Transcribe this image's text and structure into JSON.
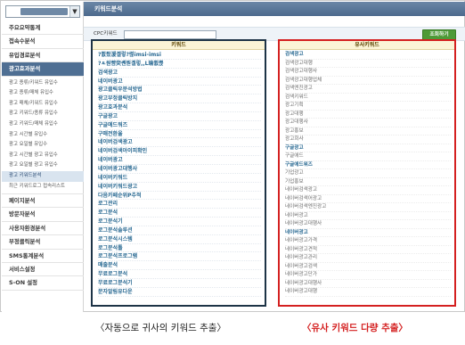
{
  "sidebar": {
    "site_select_icon": "chevron-down-icon",
    "menu": [
      {
        "label": "주요요약통계",
        "active": false
      },
      {
        "label": "접속수분석",
        "active": false
      },
      {
        "label": "유입경로분석",
        "active": false
      },
      {
        "label": "광고효과분석",
        "active": true
      }
    ],
    "submenu": [
      {
        "label": "광고 종류/키워드 유입수",
        "active": false
      },
      {
        "label": "광고 종류/매체 유입수",
        "active": false
      },
      {
        "label": "광고 매체/키워드 유입수",
        "active": false
      },
      {
        "label": "광고 키워드/종류 유입수",
        "active": false
      },
      {
        "label": "광고 키워드/매체 유입수",
        "active": false
      },
      {
        "label": "광고 시간별 유입수",
        "active": false
      },
      {
        "label": "광고 요일별 유입수",
        "active": false
      },
      {
        "label": "광고 시간별 광고 유입수",
        "active": false
      },
      {
        "label": "광고 요일별 광고 유입수",
        "active": false
      },
      {
        "label": "광고 키워드분석",
        "active": true
      },
      {
        "label": "최근 키워드로그 접속리스트",
        "active": false
      }
    ],
    "menu_bottom": [
      {
        "label": "페이지분석"
      },
      {
        "label": "방문자분석"
      },
      {
        "label": "사용자환경분석"
      },
      {
        "label": "부정클릭분석"
      },
      {
        "label": "SMS통계분석"
      },
      {
        "label": "서비스설정"
      },
      {
        "label": "S-ON 설정"
      }
    ]
  },
  "main": {
    "title": "키워드분석",
    "filter": {
      "label": "CPC키워드",
      "input_value": "",
      "search_button": "조회하기"
    },
    "keyword_panel": {
      "header": "키워드",
      "rows": [
        "?쀬룄湲곌렇?렪imsi-imsi",
        "?ㅻ원뺨臾쏀븯곌렇,,L瑜쀬쁝",
        "검색광고",
        "네이버광고",
        "광고클릭우분석방법",
        "광고부정클릭방지",
        "광고효과분석",
        "구글광고",
        "구글애드워즈",
        "구매전환율",
        "네이버검색광고",
        "네이버검색아이피확인",
        "네이버광고",
        "네이버광고대행사",
        "네이버키워드",
        "네이버키워드광고",
        "다음카페순위P추적",
        "로그관리",
        "로그분석",
        "로그분석기",
        "로그분석솔루션",
        "로그분석시스템",
        "로그분석툴",
        "로그분석프로그램",
        "매출분석",
        "무료로그분석",
        "무료로그분석기",
        "문자알림유다운"
      ]
    },
    "similar_panel": {
      "header": "유사키워드",
      "rows": [
        {
          "text": "검색광고",
          "highlight": true
        },
        {
          "text": "검색광고대행",
          "highlight": false
        },
        {
          "text": "검색광고대행사",
          "highlight": false
        },
        {
          "text": "검색광고대행업체",
          "highlight": false
        },
        {
          "text": "검색엔진광고",
          "highlight": false
        },
        {
          "text": "검색키워드",
          "highlight": false
        },
        {
          "text": "광고기획",
          "highlight": false
        },
        {
          "text": "광고대행",
          "highlight": false
        },
        {
          "text": "광고대행사",
          "highlight": false
        },
        {
          "text": "광고홍보",
          "highlight": false
        },
        {
          "text": "광고회사",
          "highlight": false
        },
        {
          "text": "구글광고",
          "highlight": true
        },
        {
          "text": "구글애드",
          "highlight": false
        },
        {
          "text": "구글애드워즈",
          "highlight": true
        },
        {
          "text": "기업광고",
          "highlight": false
        },
        {
          "text": "기업홍보",
          "highlight": false
        },
        {
          "text": "네이버검색광고",
          "highlight": false
        },
        {
          "text": "네이버검색어광고",
          "highlight": false
        },
        {
          "text": "네이버검색엔진광고",
          "highlight": false
        },
        {
          "text": "네이버광고",
          "highlight": false
        },
        {
          "text": "네이버광고대행사",
          "highlight": false
        },
        {
          "text": "네이버광고",
          "highlight": true
        },
        {
          "text": "네이버광고가격",
          "highlight": false
        },
        {
          "text": "네이버광고견적",
          "highlight": false
        },
        {
          "text": "네이버광고관리",
          "highlight": false
        },
        {
          "text": "네이버광고검색",
          "highlight": false
        },
        {
          "text": "네이버광고단가",
          "highlight": false
        },
        {
          "text": "네이버광고대행사",
          "highlight": false
        },
        {
          "text": "네이버광고대행",
          "highlight": false
        }
      ]
    }
  },
  "captions": {
    "left": "〈자동으로 귀사의 키워드 추출〉",
    "right": "〈유사 키워드 다량 추출〉"
  },
  "colors": {
    "header_bg": "#4f6f93",
    "keyword_border": "#1d3346",
    "similar_border": "#d42020",
    "search_button": "#4e9a37"
  }
}
